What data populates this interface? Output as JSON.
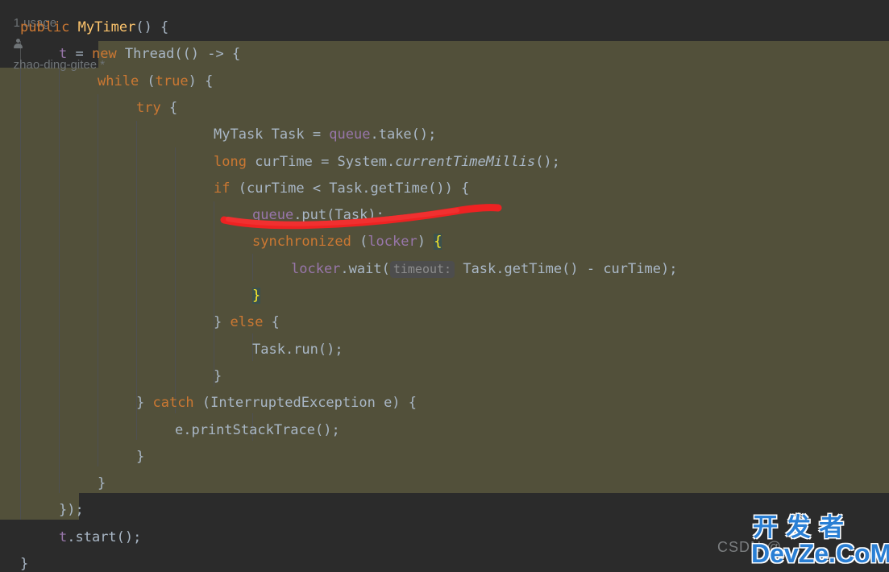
{
  "editor": {
    "theme": "darcula",
    "background": "#2b2b2b",
    "selection_background": "#52503a",
    "default_text_color": "#a9b7c6",
    "keyword_color": "#cc7832",
    "field_color": "#9876aa",
    "constructor_color": "#ffc66d",
    "brace_match_background": "#3b514d",
    "brace_match_color": "#ffef28",
    "hint_background": "#4d4d4d",
    "hint_color": "#8c8c8c",
    "annotation_color": "#ee2222"
  },
  "code_vision": {
    "usages": "1 usage",
    "author": "zhao-ding-gitee *",
    "author_icon": "person-icon"
  },
  "code": {
    "lines": [
      {
        "id": "line-public-mytimer",
        "indent": "",
        "tokens": [
          {
            "t": "public",
            "c": "kw"
          },
          {
            "t": " ",
            "c": "txt"
          },
          {
            "t": "MyTimer",
            "c": "ctor"
          },
          {
            "t": "() {",
            "c": "txt"
          }
        ]
      },
      {
        "id": "line-t-new-thread",
        "indent": "    ",
        "tokens": [
          {
            "t": "t",
            "c": "field"
          },
          {
            "t": " = ",
            "c": "txt"
          },
          {
            "t": "new",
            "c": "kw"
          },
          {
            "t": " Thread(() -> {",
            "c": "txt"
          }
        ]
      },
      {
        "id": "line-while-true",
        "indent": "        ",
        "tokens": [
          {
            "t": "while",
            "c": "kw"
          },
          {
            "t": " (",
            "c": "txt"
          },
          {
            "t": "true",
            "c": "kw"
          },
          {
            "t": ") {",
            "c": "txt"
          }
        ]
      },
      {
        "id": "line-try",
        "indent": "            ",
        "tokens": [
          {
            "t": "try",
            "c": "kw"
          },
          {
            "t": " {",
            "c": "txt"
          }
        ]
      },
      {
        "id": "line-mytask-take",
        "indent": "                    ",
        "tokens": [
          {
            "t": "MyTask Task = ",
            "c": "txt"
          },
          {
            "t": "queue",
            "c": "field"
          },
          {
            "t": ".take();",
            "c": "txt"
          }
        ]
      },
      {
        "id": "line-long-curtime",
        "indent": "                    ",
        "tokens": [
          {
            "t": "long",
            "c": "kw"
          },
          {
            "t": " curTime = System.",
            "c": "txt"
          },
          {
            "t": "currentTimeMillis",
            "c": "ital"
          },
          {
            "t": "();",
            "c": "txt"
          }
        ]
      },
      {
        "id": "line-if-curtime",
        "indent": "                    ",
        "tokens": [
          {
            "t": "if",
            "c": "kw"
          },
          {
            "t": " (curTime < Task.getTime()) {",
            "c": "txt"
          }
        ]
      },
      {
        "id": "line-queue-put",
        "indent": "                        ",
        "tokens": [
          {
            "t": "queue",
            "c": "field"
          },
          {
            "t": ".put(Task);",
            "c": "txt"
          }
        ]
      },
      {
        "id": "line-synchronized-locker",
        "indent": "                        ",
        "tokens": [
          {
            "t": "synchronized",
            "c": "kw"
          },
          {
            "t": " (",
            "c": "txt"
          },
          {
            "t": "locker",
            "c": "field"
          },
          {
            "t": ") ",
            "c": "txt"
          },
          {
            "t": "{",
            "c": "brace-hl"
          }
        ]
      },
      {
        "id": "line-locker-wait",
        "indent": "                            ",
        "tokens": [
          {
            "t": "locker",
            "c": "field"
          },
          {
            "t": ".wait(",
            "c": "txt"
          },
          {
            "t": "timeout:",
            "c": "hint"
          },
          {
            "t": " Task.getTime() - curTime);",
            "c": "txt"
          }
        ]
      },
      {
        "id": "line-close-sync",
        "indent": "                        ",
        "tokens": [
          {
            "t": "}",
            "c": "brace-hl"
          }
        ]
      },
      {
        "id": "line-else",
        "indent": "                    ",
        "tokens": [
          {
            "t": "} ",
            "c": "txt"
          },
          {
            "t": "else",
            "c": "kw"
          },
          {
            "t": " {",
            "c": "txt"
          }
        ]
      },
      {
        "id": "line-task-run",
        "indent": "                        ",
        "tokens": [
          {
            "t": "Task.run();",
            "c": "txt"
          }
        ]
      },
      {
        "id": "line-close-else",
        "indent": "                    ",
        "tokens": [
          {
            "t": "}",
            "c": "txt"
          }
        ]
      },
      {
        "id": "line-catch",
        "indent": "            ",
        "tokens": [
          {
            "t": "} ",
            "c": "txt"
          },
          {
            "t": "catch",
            "c": "kw"
          },
          {
            "t": " (InterruptedException e) {",
            "c": "txt"
          }
        ]
      },
      {
        "id": "line-printstacktrace",
        "indent": "                ",
        "tokens": [
          {
            "t": "e.printStackTrace();",
            "c": "txt"
          }
        ]
      },
      {
        "id": "line-close-catch",
        "indent": "            ",
        "tokens": [
          {
            "t": "}",
            "c": "txt"
          }
        ]
      },
      {
        "id": "line-close-while",
        "indent": "        ",
        "tokens": [
          {
            "t": "}",
            "c": "txt"
          }
        ]
      },
      {
        "id": "line-close-lambda",
        "indent": "    ",
        "tokens": [
          {
            "t": "});",
            "c": "txt"
          }
        ]
      },
      {
        "id": "line-t-start",
        "indent": "    ",
        "tokens": [
          {
            "t": "t",
            "c": "field"
          },
          {
            "t": ".start();",
            "c": "txt"
          }
        ]
      },
      {
        "id": "line-close-ctor",
        "indent": "",
        "tokens": [
          {
            "t": "}",
            "c": "txt"
          }
        ]
      }
    ]
  },
  "watermark": {
    "csdn": "CSDN @",
    "chinese": "开发者",
    "site": "DevZe.CoM"
  }
}
